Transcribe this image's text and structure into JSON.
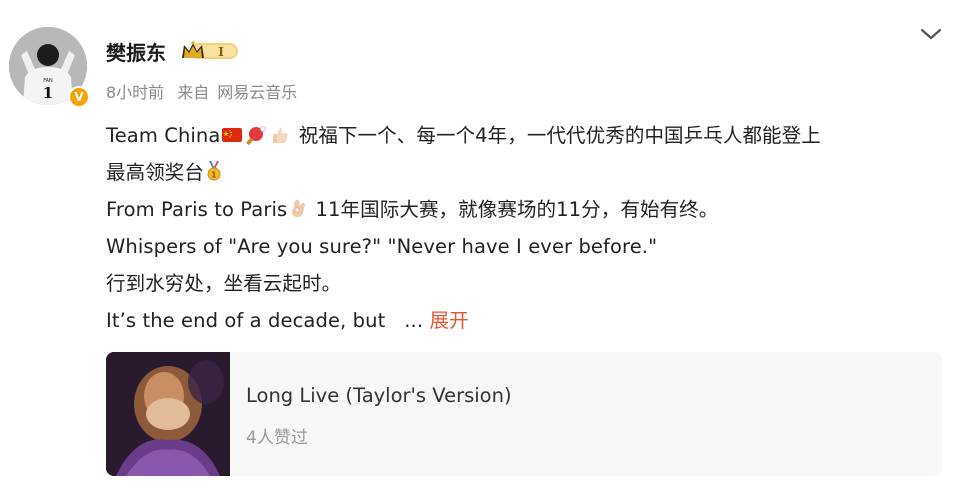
{
  "post": {
    "username": "樊振东",
    "meta": {
      "time": "8小时前",
      "source_prefix": "来自",
      "source": "网易云音乐"
    },
    "lines": {
      "l1_start": "Team China",
      "l1_end": " 祝福下一个、每一个4年，一代代优秀的中国乒乓人都能登上",
      "l2_start": "最高领奖台",
      "l3_start": "From Paris to Paris",
      "l3_end": " 11年国际大赛，就像赛场的11分，有始有终。",
      "l4": "Whispers of \"Are you sure?\" \"Never have I ever before.\"",
      "l5": "行到水穷处，坐看云起时。",
      "l6": "It’s the end of a decade, but  ",
      "ellipsis": "...",
      "expand": "展开"
    },
    "card": {
      "title": "Long Live (Taylor's Version)",
      "subtitle": "4人赞过"
    }
  },
  "colors": {
    "accent": "#e8552c",
    "verified": "#f5a200",
    "meta": "#8a8a8a",
    "card_bg": "#f7f7f7"
  },
  "icons": [
    "flag-china-icon",
    "ping-pong-icon",
    "thumbs-up-icon",
    "medal-icon",
    "ok-hand-icon",
    "chevron-down-icon",
    "verified-v-icon",
    "member-crown-badge"
  ]
}
